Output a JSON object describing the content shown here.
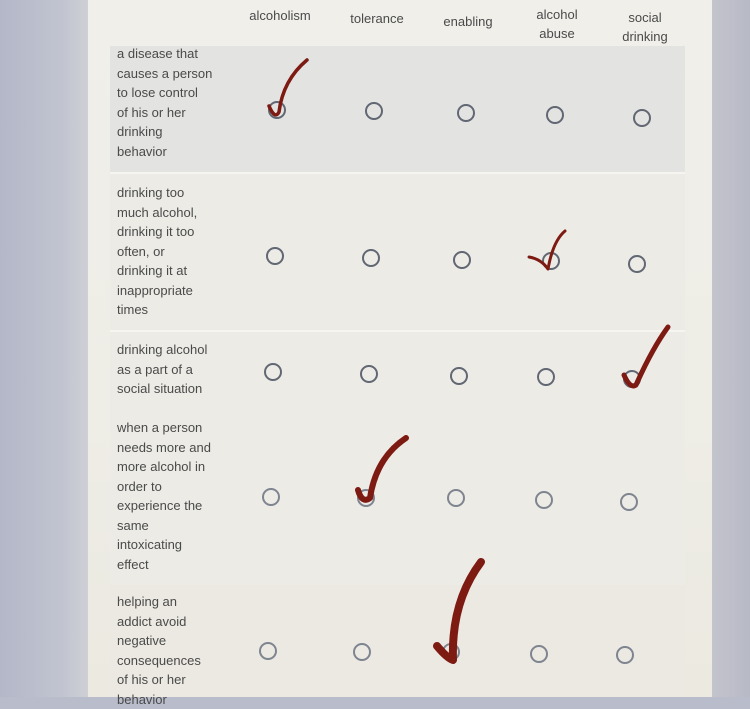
{
  "columns": [
    {
      "key": "alcoholism",
      "lines": [
        "alcoholism"
      ]
    },
    {
      "key": "tolerance",
      "lines": [
        "tolerance"
      ]
    },
    {
      "key": "enabling",
      "lines": [
        "enabling"
      ]
    },
    {
      "key": "alcohol_abuse",
      "lines": [
        "alcohol",
        "abuse"
      ]
    },
    {
      "key": "social_drinking",
      "lines": [
        "social",
        "drinking"
      ]
    }
  ],
  "rows": [
    {
      "lines": [
        "a disease that",
        "causes a person",
        "to lose control",
        "of his or her",
        "drinking",
        "behavior"
      ],
      "selected": "alcoholism"
    },
    {
      "lines": [
        "drinking too",
        "much alcohol,",
        "drinking it too",
        "often, or",
        "drinking it at",
        "inappropriate",
        "times"
      ],
      "selected": "alcohol_abuse"
    },
    {
      "lines": [
        "drinking alcohol",
        "as a part of a",
        "social situation"
      ],
      "selected": "social_drinking"
    },
    {
      "lines": [
        "when a person",
        "needs more and",
        "more alcohol in",
        "order to",
        "experience the",
        "same",
        "intoxicating",
        "effect"
      ],
      "selected": "tolerance"
    },
    {
      "lines": [
        "helping an",
        "addict avoid",
        "negative",
        "consequences",
        "of his or her",
        "behavior"
      ],
      "selected": "enabling"
    }
  ],
  "colors": {
    "check_mark": "#7d1a12",
    "radio_border": "#616773",
    "text": "#4a4a4a"
  }
}
